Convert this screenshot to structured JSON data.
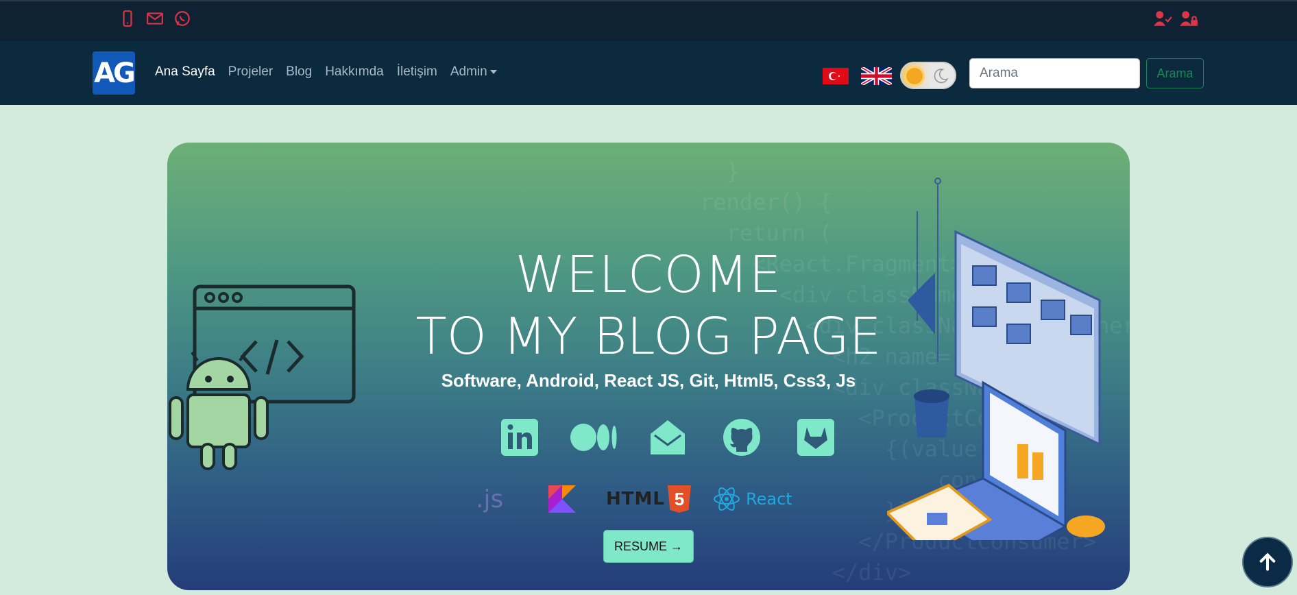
{
  "topbar": {
    "contact_icons": [
      "phone-icon",
      "mail-icon",
      "whatsapp-icon"
    ],
    "auth_icons": [
      "user-check-icon",
      "user-lock-icon"
    ],
    "icon_color": "#dc3545"
  },
  "navbar": {
    "logo_text": "AG",
    "links": [
      {
        "label": "Ana Sayfa",
        "active": true
      },
      {
        "label": "Projeler"
      },
      {
        "label": "Blog"
      },
      {
        "label": "Hakkımda"
      },
      {
        "label": "İletişim"
      },
      {
        "label": "Admin",
        "dropdown": true
      }
    ],
    "flags": [
      "turkey-flag",
      "uk-flag"
    ],
    "theme_toggle": "sun-moon-toggle",
    "search": {
      "placeholder": "Arama",
      "value": "",
      "button_label": "Arama"
    }
  },
  "hero": {
    "title_line1": "WELCOME",
    "title_line2": "TO MY BLOG PAGE",
    "skills": "Software, Android, React JS, Git, Html5, Css3, Js",
    "social_icons": [
      "linkedin-icon",
      "medium-icon",
      "email-icon",
      "github-icon",
      "gitlab-icon"
    ],
    "tech": {
      "js": ".js",
      "html": "HTML",
      "html_badge": "5",
      "react": "React"
    },
    "resume_label": "RESUME →",
    "accent_color": "#7ee8c8"
  },
  "scroll_top": "arrow-up-icon"
}
